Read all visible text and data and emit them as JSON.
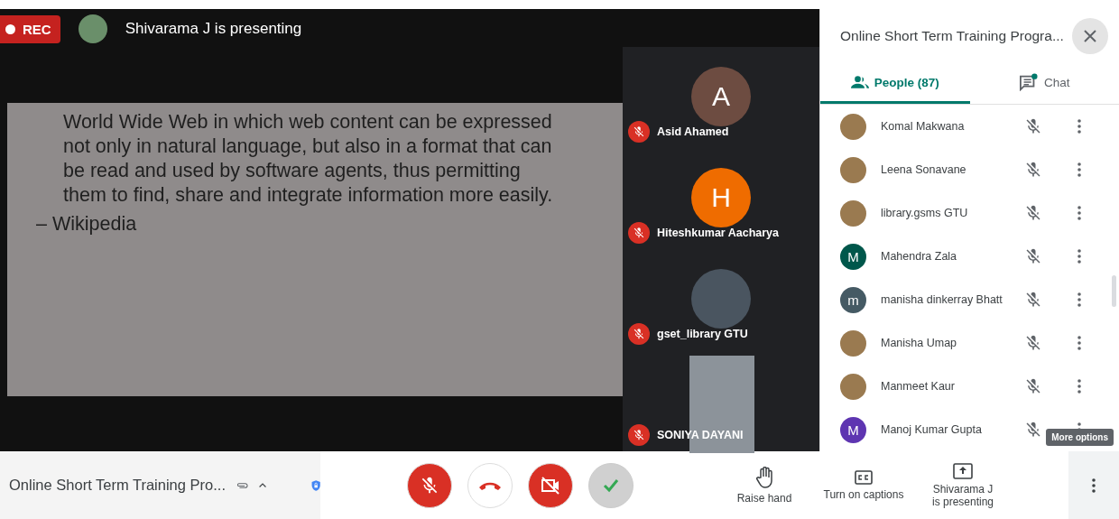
{
  "recording": {
    "label": "REC"
  },
  "presenter_banner": {
    "text": "Shivarama J is presenting"
  },
  "slide": {
    "paragraph": "World Wide Web in which web content can be expressed not only in natural language, but also in a format that can be read and used by software agents, thus permitting them to find, share and integrate information more easily.",
    "attribution": "– Wikipedia"
  },
  "tiles": [
    {
      "name": "Asid Ahamed",
      "kind": "initial",
      "initial": "A",
      "color": "#6d4c41",
      "muted": true
    },
    {
      "name": "Hiteshkumar Aacharya",
      "kind": "initial",
      "initial": "H",
      "color": "#ef6c00",
      "muted": true
    },
    {
      "name": "gset_library GTU",
      "kind": "photo",
      "muted": true
    },
    {
      "name": "SONIYA DAYANI",
      "kind": "video",
      "muted": true
    }
  ],
  "panel": {
    "title": "Online Short Term Training Progra...",
    "tabs": [
      {
        "label": "People (87)",
        "kind": "people",
        "selected": true
      },
      {
        "label": "Chat",
        "kind": "chat",
        "selected": false
      }
    ],
    "participants": [
      {
        "name": "Komal Makwana",
        "kind": "photo",
        "muted": true
      },
      {
        "name": "Leena Sonavane",
        "kind": "photo",
        "muted": true
      },
      {
        "name": "library.gsms GTU",
        "kind": "photo",
        "muted": true
      },
      {
        "name": "Mahendra Zala",
        "kind": "initial",
        "initial": "M",
        "color": "#00574b",
        "muted": true
      },
      {
        "name": "manisha dinkerray Bhatt",
        "kind": "initial",
        "initial": "m",
        "color": "#455a64",
        "muted": true
      },
      {
        "name": "Manisha Umap",
        "kind": "photo",
        "muted": true
      },
      {
        "name": "Manmeet Kaur",
        "kind": "photo",
        "muted": true
      },
      {
        "name": "Manoj Kumar Gupta",
        "kind": "initial",
        "initial": "M",
        "color": "#5e35b1",
        "muted": true
      }
    ],
    "tooltip": "More options"
  },
  "meeting_title": "Online Short Term Training Pro...",
  "controls": [
    {
      "kind": "mic",
      "on": false
    },
    {
      "kind": "hangup"
    },
    {
      "kind": "camera",
      "on": false
    },
    {
      "kind": "ok"
    }
  ],
  "actions": [
    {
      "kind": "hand",
      "label": "Raise hand"
    },
    {
      "kind": "captions",
      "label": "Turn on captions"
    },
    {
      "kind": "present",
      "label": "Shivarama J\nis presenting"
    }
  ]
}
